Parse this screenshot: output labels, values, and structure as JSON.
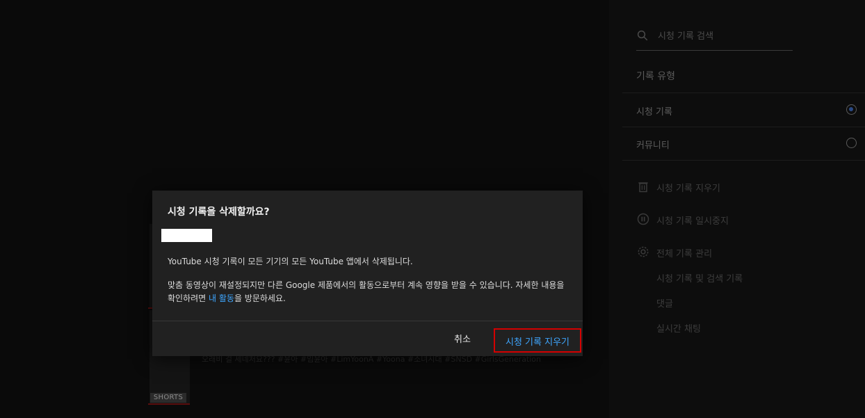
{
  "sidebar": {
    "search_placeholder": "시청 기록 검색",
    "section_title": "기록 유형",
    "radio_options": [
      {
        "label": "시청 기록",
        "checked": true
      },
      {
        "label": "커뮤니티",
        "checked": false
      }
    ],
    "actions": [
      {
        "label": "시청 기록 지우기",
        "icon": "trash-icon"
      },
      {
        "label": "시청 기록 일시중지",
        "icon": "pause-circle-icon"
      },
      {
        "label": "전체 기록 관리",
        "icon": "gear-icon"
      }
    ],
    "sub_items": [
      "시청 기록 및 검색 기록",
      "댓글",
      "실시간 채팅"
    ]
  },
  "background": {
    "shorts_badge": "SHORTS",
    "tags_text": "오래비 걸 세네처요??? #윤아 #임윤아 #LimYoonA #Yoona #소녀시대 #SNSD #GirlsGeneration"
  },
  "dialog": {
    "title": "시청 기록을 삭제할까요?",
    "paragraph1": "YouTube 시청 기록이 모든 기기의 모든 YouTube 앱에서 삭제됩니다.",
    "paragraph2_before": " 맞춤 동영상이 재설정되지만 다른 Google 제품에서의 활동으로부터 계속 영향을 받을 수 있습니다. 자세한 내용을 확인하려면 ",
    "paragraph2_link": "내 활동",
    "paragraph2_after": "을 방문하세요.",
    "cancel_label": "취소",
    "confirm_label": "시청 기록 지우기"
  },
  "colors": {
    "accent": "#3ea6ff",
    "highlight_outline": "#d40000",
    "dialog_bg": "#212121"
  }
}
